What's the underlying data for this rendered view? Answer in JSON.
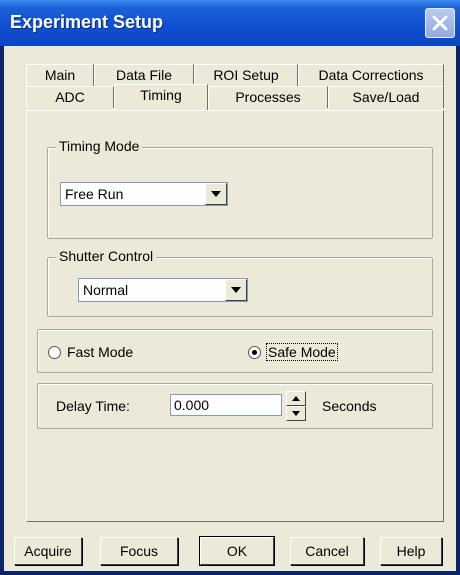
{
  "window": {
    "title": "Experiment Setup"
  },
  "tabs": {
    "row1": [
      {
        "label": "Main"
      },
      {
        "label": "Data File"
      },
      {
        "label": "ROI Setup"
      },
      {
        "label": "Data Corrections"
      }
    ],
    "row2": [
      {
        "label": "ADC"
      },
      {
        "label": "Timing"
      },
      {
        "label": "Processes"
      },
      {
        "label": "Save/Load"
      }
    ],
    "active": "Timing"
  },
  "timing_mode": {
    "label": "Timing Mode",
    "selected": "Free Run"
  },
  "shutter_control": {
    "label": "Shutter Control",
    "selected": "Normal"
  },
  "mode": {
    "fast_label": "Fast Mode",
    "safe_label": "Safe Mode",
    "selected": "Safe Mode"
  },
  "delay": {
    "label": "Delay Time:",
    "value": "0.000",
    "unit": "Seconds"
  },
  "buttons": {
    "acquire": "Acquire",
    "focus": "Focus",
    "ok": "OK",
    "cancel": "Cancel",
    "help": "Help"
  },
  "colors": {
    "titlebar": "#0a45c4",
    "dialog_bg": "#ece9d8",
    "field_border": "#7f9db9"
  },
  "icons": {
    "close": "close-icon",
    "dropdown": "chevron-down-icon",
    "spin_up": "spin-up-icon",
    "spin_down": "spin-down-icon"
  }
}
